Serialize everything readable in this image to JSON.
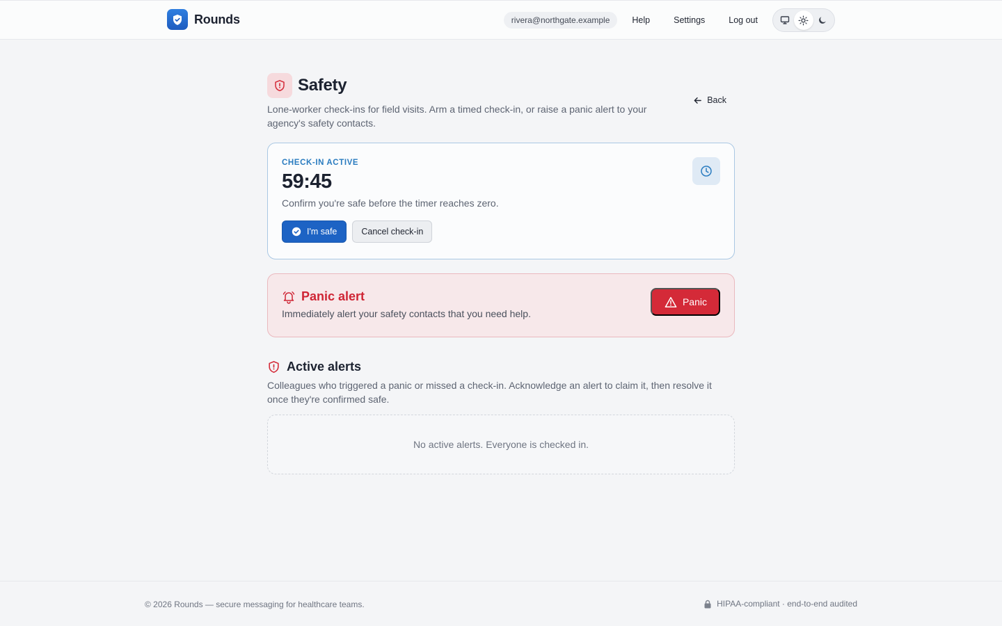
{
  "header": {
    "brand_name": "Rounds",
    "user_email": "rivera@northgate.example",
    "nav": {
      "help": "Help",
      "settings": "Settings",
      "logout": "Log out"
    },
    "theme_options": [
      "system",
      "light",
      "dark"
    ],
    "theme_selected": "light"
  },
  "page": {
    "title": "Safety",
    "subtitle": "Lone-worker check-ins for field visits. Arm a timed check-in, or raise a panic alert to your agency's safety contacts.",
    "back_label": "Back"
  },
  "checkin": {
    "status": "Check-in active",
    "timer": "59:45",
    "note": "Confirm you're safe before the timer reaches zero.",
    "safe_label": "I'm safe",
    "cancel_label": "Cancel check-in"
  },
  "panic": {
    "title": "Panic alert",
    "note": "Immediately alert your safety contacts that you need help.",
    "button_label": "Panic"
  },
  "alerts": {
    "title": "Active alerts",
    "subtitle": "Colleagues who triggered a panic or missed a check-in. Acknowledge an alert to claim it, then resolve it once they're confirmed safe.",
    "empty_message": "No active alerts. Everyone is checked in."
  },
  "footer": {
    "left": "© 2026 Rounds — secure messaging for healthcare teams.",
    "right": "HIPAA-compliant · end-to-end audited"
  },
  "colors": {
    "primary": "#1d63c4",
    "danger": "#d42a38",
    "accent_blue": "#2a7cc0"
  }
}
